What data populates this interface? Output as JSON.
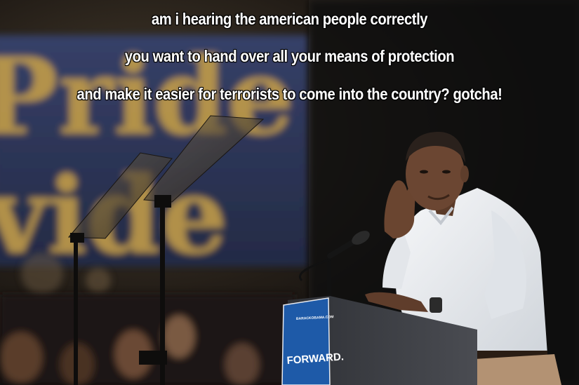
{
  "meme": {
    "caption_lines": [
      "am i hearing the american  people correctly",
      "you want to hand over all your means  of protection",
      "and make it easier  for terrorists to come into the country?   gotcha!"
    ]
  },
  "scene": {
    "banner_text_top": "Pride",
    "banner_text_bottom": "vide",
    "podium_sign_small": "BARACKOBAMA.COM",
    "podium_sign_main": "FORWARD."
  },
  "colors": {
    "background": "#141210",
    "banner": "#2d3558",
    "banner_text": "#caa248",
    "shirt": "#e9ecef",
    "podium_sign": "#1e5aa8",
    "podium": "#3a3c40"
  }
}
